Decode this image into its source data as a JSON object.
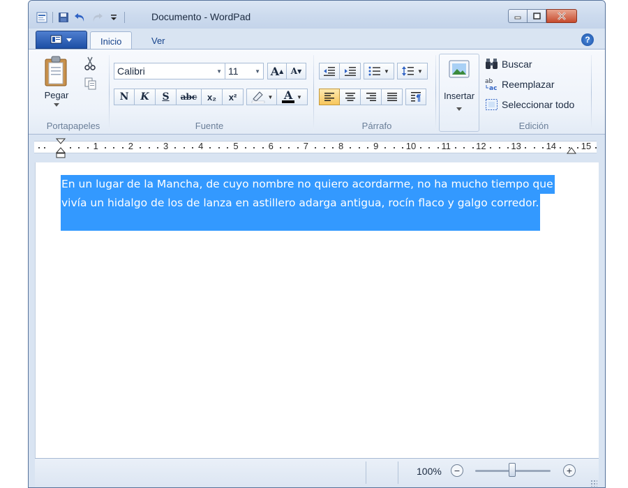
{
  "window": {
    "title": "Documento - WordPad"
  },
  "tabs": [
    {
      "label": "Inicio"
    },
    {
      "label": "Ver"
    }
  ],
  "help_label": "?",
  "clipboard": {
    "paste_label": "Pegar",
    "group_label": "Portapapeles"
  },
  "font": {
    "family": "Calibri",
    "size": "11",
    "grow_label": "A",
    "shrink_label": "A",
    "bold": "N",
    "italic": "K",
    "underline": "S",
    "strike": "abc",
    "subscript": "x₂",
    "superscript": "x²",
    "color_label": "A",
    "group_label": "Fuente"
  },
  "paragraph": {
    "group_label": "Párrafo"
  },
  "insert": {
    "label": "Insertar"
  },
  "edit": {
    "find_label": "Buscar",
    "replace_label": "Reemplazar",
    "select_all_label": "Seleccionar todo",
    "group_label": "Edición"
  },
  "ruler": {
    "numbers": [
      "1",
      "2",
      "3",
      "4",
      "5",
      "6",
      "7",
      "8",
      "9",
      "10",
      "11",
      "12",
      "13",
      "14",
      "15"
    ]
  },
  "document": {
    "line1": "En un lugar de la Mancha, de cuyo nombre no quiero acordarme, no ha mucho tiempo que",
    "line2": "vivía un hidalgo de los de lanza en astillero adarga antigua, rocín flaco y galgo corredor."
  },
  "status": {
    "zoom": "100%"
  },
  "colors": {
    "selection": "#3399ff",
    "title_bar": "#c4d4ea",
    "close_button": "#c64a2d",
    "app_menu": "#1d4fa5"
  }
}
